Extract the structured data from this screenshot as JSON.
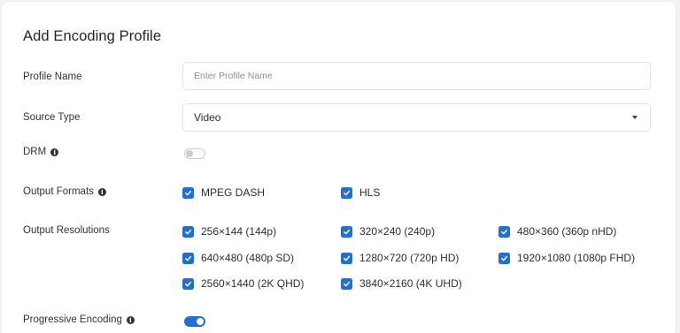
{
  "form": {
    "title": "Add Encoding Profile",
    "profile_name": {
      "label": "Profile Name",
      "placeholder": "Enter Profile Name",
      "value": ""
    },
    "source_type": {
      "label": "Source Type",
      "selected": "Video"
    },
    "drm": {
      "label": "DRM",
      "enabled": false
    },
    "output_formats": {
      "label": "Output Formats",
      "options": [
        {
          "label": "MPEG DASH",
          "checked": true
        },
        {
          "label": "HLS",
          "checked": true
        }
      ]
    },
    "output_resolutions": {
      "label": "Output Resolutions",
      "options": [
        {
          "label": "256×144 (144p)",
          "checked": true
        },
        {
          "label": "320×240 (240p)",
          "checked": true
        },
        {
          "label": "480×360 (360p nHD)",
          "checked": true
        },
        {
          "label": "640×480 (480p SD)",
          "checked": true
        },
        {
          "label": "1280×720 (720p HD)",
          "checked": true
        },
        {
          "label": "1920×1080 (1080p FHD)",
          "checked": true
        },
        {
          "label": "2560×1440 (2K QHD)",
          "checked": true
        },
        {
          "label": "3840×2160 (4K UHD)",
          "checked": true
        }
      ]
    },
    "progressive_encoding": {
      "label": "Progressive Encoding",
      "enabled": true
    }
  },
  "icons": {
    "info": "info-icon",
    "caret": "chevron-down-icon",
    "check": "checkmark-icon"
  },
  "colors": {
    "accent": "#1f6fd6",
    "toggle_off": "#c9ccd1",
    "border": "#dfe2e6"
  }
}
